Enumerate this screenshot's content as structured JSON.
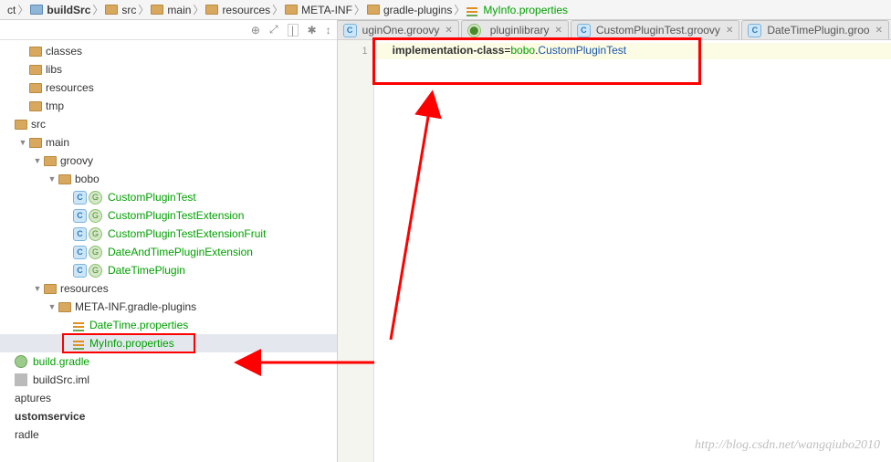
{
  "breadcrumb": {
    "items": [
      {
        "label": "ct"
      },
      {
        "label": "buildSrc"
      },
      {
        "label": "src"
      },
      {
        "label": "main"
      },
      {
        "label": "resources"
      },
      {
        "label": "META-INF"
      },
      {
        "label": "gradle-plugins"
      },
      {
        "label": "MyInfo.properties"
      }
    ]
  },
  "toolbar": {
    "target": "⊕",
    "expand": "⤢",
    "gear": "✱",
    "collapse": "↕"
  },
  "tree": {
    "items": [
      {
        "ind": 1,
        "arrow": "",
        "icon": "folder",
        "label": "classes",
        "gr": false,
        "sel": false
      },
      {
        "ind": 1,
        "arrow": "",
        "icon": "folder",
        "label": "libs",
        "gr": false,
        "sel": false
      },
      {
        "ind": 1,
        "arrow": "",
        "icon": "folder",
        "label": "resources",
        "gr": false,
        "sel": false
      },
      {
        "ind": 1,
        "arrow": "",
        "icon": "folder",
        "label": "tmp",
        "gr": false,
        "sel": false
      },
      {
        "ind": 0,
        "arrow": "",
        "icon": "folder",
        "label": "src",
        "gr": false,
        "sel": false
      },
      {
        "ind": 1,
        "arrow": "down",
        "icon": "folder",
        "label": "main",
        "gr": false,
        "sel": false
      },
      {
        "ind": 2,
        "arrow": "down",
        "icon": "folder",
        "label": "groovy",
        "gr": false,
        "sel": false
      },
      {
        "ind": 3,
        "arrow": "down",
        "icon": "pkg",
        "label": "bobo",
        "gr": false,
        "sel": false
      },
      {
        "ind": 4,
        "arrow": "",
        "icon": "cg",
        "label": "CustomPluginTest",
        "gr": true,
        "sel": false
      },
      {
        "ind": 4,
        "arrow": "",
        "icon": "cg",
        "label": "CustomPluginTestExtension",
        "gr": true,
        "sel": false
      },
      {
        "ind": 4,
        "arrow": "",
        "icon": "cg",
        "label": "CustomPluginTestExtensionFruit",
        "gr": true,
        "sel": false
      },
      {
        "ind": 4,
        "arrow": "",
        "icon": "cg",
        "label": "DateAndTimePluginExtension",
        "gr": true,
        "sel": false
      },
      {
        "ind": 4,
        "arrow": "",
        "icon": "cg",
        "label": "DateTimePlugin",
        "gr": true,
        "sel": false
      },
      {
        "ind": 2,
        "arrow": "down",
        "icon": "folder",
        "label": "resources",
        "gr": false,
        "sel": false
      },
      {
        "ind": 3,
        "arrow": "down",
        "icon": "pkg",
        "label": "META-INF.gradle-plugins",
        "gr": false,
        "sel": false
      },
      {
        "ind": 4,
        "arrow": "",
        "icon": "prop",
        "label": "DateTime.properties",
        "gr": true,
        "sel": false
      },
      {
        "ind": 4,
        "arrow": "",
        "icon": "prop",
        "label": "MyInfo.properties",
        "gr": true,
        "sel": true
      },
      {
        "ind": 0,
        "arrow": "",
        "icon": "gradle",
        "label": "build.gradle",
        "gr": true,
        "sel": false
      },
      {
        "ind": 0,
        "arrow": "",
        "icon": "iml",
        "label": "buildSrc.iml",
        "gr": false,
        "sel": false
      },
      {
        "ind": 0,
        "arrow": "",
        "icon": "none",
        "label": "aptures",
        "gr": false,
        "sel": false
      },
      {
        "ind": 0,
        "arrow": "",
        "icon": "none",
        "label": "ustomservice",
        "gr": false,
        "bold": true,
        "sel": false
      },
      {
        "ind": 0,
        "arrow": "",
        "icon": "none",
        "label": "radle",
        "gr": false,
        "sel": false
      }
    ]
  },
  "tabs": {
    "items": [
      {
        "label": "uginOne.groovy",
        "icon": "c",
        "partial": true
      },
      {
        "label": "pluginlibrary",
        "icon": "g"
      },
      {
        "label": "CustomPluginTest.groovy",
        "icon": "c"
      },
      {
        "label": "DateTimePlugin.groo",
        "icon": "c"
      }
    ]
  },
  "editor": {
    "line_number": "1",
    "code_key": "implementation-class",
    "code_eq": "=",
    "code_pkg": "bobo",
    "code_dot": ".",
    "code_cls": "CustomPluginTest"
  },
  "watermark": "http://blog.csdn.net/wangqiubo2010"
}
